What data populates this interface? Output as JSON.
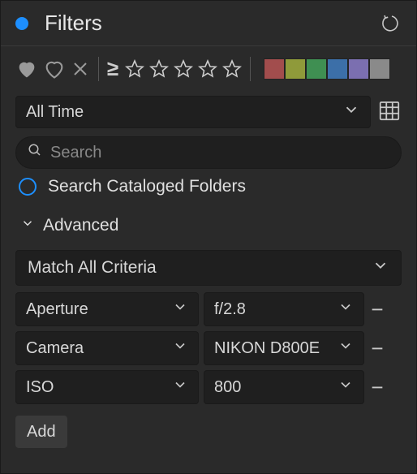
{
  "header": {
    "title": "Filters"
  },
  "colors": {
    "swatches": [
      "#a24d4d",
      "#8f9a3a",
      "#3f8f52",
      "#3c6fa8",
      "#7b6fb0",
      "#8a8a8a"
    ]
  },
  "time_dropdown": {
    "label": "All Time"
  },
  "search": {
    "placeholder": "Search",
    "radio_label": "Search Cataloged Folders"
  },
  "advanced": {
    "label": "Advanced",
    "match_label": "Match All Criteria",
    "rows": [
      {
        "key": "Aperture",
        "value": "f/2.8"
      },
      {
        "key": "Camera",
        "value": "NIKON D800E"
      },
      {
        "key": "ISO",
        "value": "800"
      }
    ],
    "add_label": "Add"
  }
}
